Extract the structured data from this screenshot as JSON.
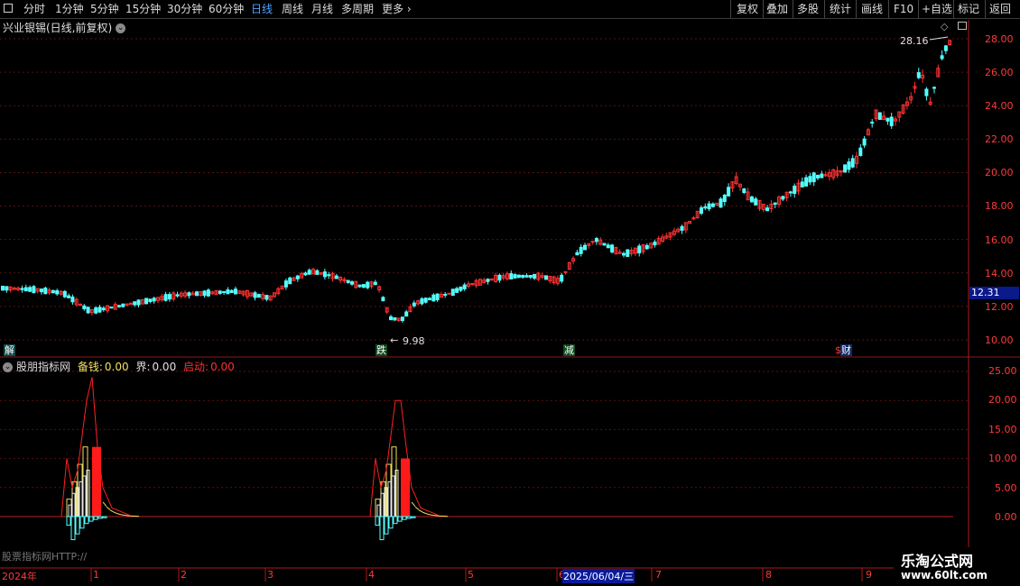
{
  "toolbar": {
    "periods": [
      "分时",
      "1分钟",
      "5分钟",
      "15分钟",
      "30分钟",
      "60分钟",
      "日线",
      "周线",
      "月线",
      "多周期",
      "更多"
    ],
    "selected_period": "日线",
    "right_buttons": [
      "复权",
      "叠加",
      "多股",
      "统计",
      "画线",
      "F10",
      "+自选",
      "标记",
      "返回"
    ]
  },
  "chart_title": "兴业银锡(日线,前复权)",
  "price_axis": [
    "28.00",
    "26.00",
    "24.00",
    "22.00",
    "20.00",
    "18.00",
    "16.00",
    "14.00",
    "12.00",
    "10.00"
  ],
  "current_price_tag": "12.31",
  "high_label": "28.16",
  "low_label": "9.98",
  "event_tags": [
    {
      "text": "解",
      "color": "#24c0c0"
    },
    {
      "text": "跌",
      "color": "#24c064"
    },
    {
      "text": "减",
      "color": "#24c064"
    },
    {
      "text": "$",
      "color": "#ff3a3a"
    },
    {
      "text": "财",
      "color": "#3a8cff"
    }
  ],
  "indicator": {
    "name": "股朋指标网",
    "items": [
      {
        "label": "备钱:",
        "value": "0.00",
        "color": "#f0e060"
      },
      {
        "label": "界:",
        "value": "0.00",
        "color": "#e0e0e0"
      },
      {
        "label": "启动:",
        "value": "0.00",
        "color": "#ff3030"
      }
    ],
    "axis": [
      "25.00",
      "20.00",
      "15.00",
      "10.00",
      "5.00",
      "0.00"
    ]
  },
  "watermark": "股票指标网HTTP://",
  "date_axis": {
    "labels": [
      "2024年",
      "1",
      "2",
      "3",
      "4",
      "5",
      "6",
      "7",
      "8",
      "9"
    ],
    "cursor_date": "2025/06/04/三"
  },
  "logo": {
    "line1": "乐淘公式网",
    "line2": "www.60lt.com"
  },
  "colors": {
    "up": "#ff3232",
    "down": "#54ffff",
    "grid": "#5a1010",
    "axis_text": "#ff3a3a"
  }
}
